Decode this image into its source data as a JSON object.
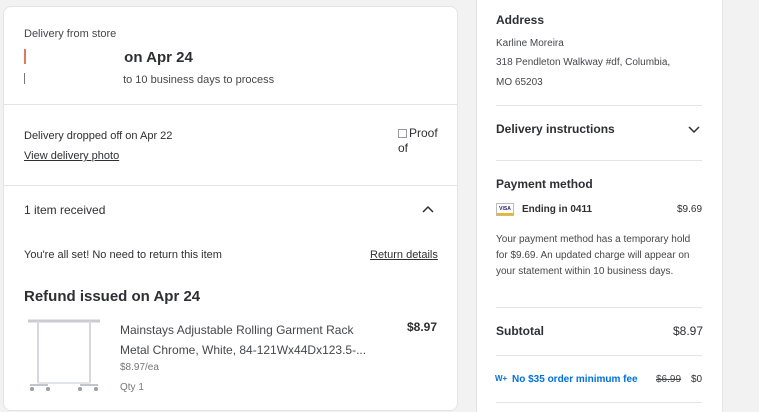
{
  "order": {
    "delivery_label": "Delivery from store",
    "arrival_date": "on Apr 24",
    "arrival_prefix": "I",
    "process_prefix": "I",
    "process_text": "to 10 business days to process"
  },
  "delivery": {
    "dropped_text": "Delivery dropped off on Apr 22",
    "view_photo_label": "View delivery photo",
    "proof_image_alt": "Proof of"
  },
  "items": {
    "received_label": "1 item received",
    "all_set_text": "You're all set! No need to return this item",
    "return_details_label": "Return details",
    "refund_title": "Refund issued on Apr 24",
    "products": [
      {
        "name": "Mainstays Adjustable Rolling Garment Rack Metal Chrome, White, 84-121Wx44Dx123.5-...",
        "price": "$8.97",
        "unit_price": "$8.97/ea",
        "qty": "Qty 1"
      }
    ]
  },
  "address": {
    "title": "Address",
    "name": "Karline Moreira",
    "line1": "318 Pendleton Walkway #df, Columbia,",
    "line2": "MO 65203"
  },
  "delivery_instructions": {
    "title": "Delivery instructions"
  },
  "payment": {
    "title": "Payment method",
    "card_brand": "VISA",
    "ending": "Ending in 0411",
    "amount": "$9.69",
    "note": "Your payment method has a temporary hold for $9.69. An updated charge will appear on your statement within 10 business days."
  },
  "summary": {
    "subtotal_label": "Subtotal",
    "subtotal_value": "$8.97",
    "wplus_label": "W+",
    "min_fee_label": "No $35 order minimum fee",
    "fee_old": "$6.99",
    "fee_new": "$0"
  },
  "colors": {
    "accent_blue": "#0071dc",
    "border": "#e3e4e5",
    "text": "#2e2f32"
  }
}
